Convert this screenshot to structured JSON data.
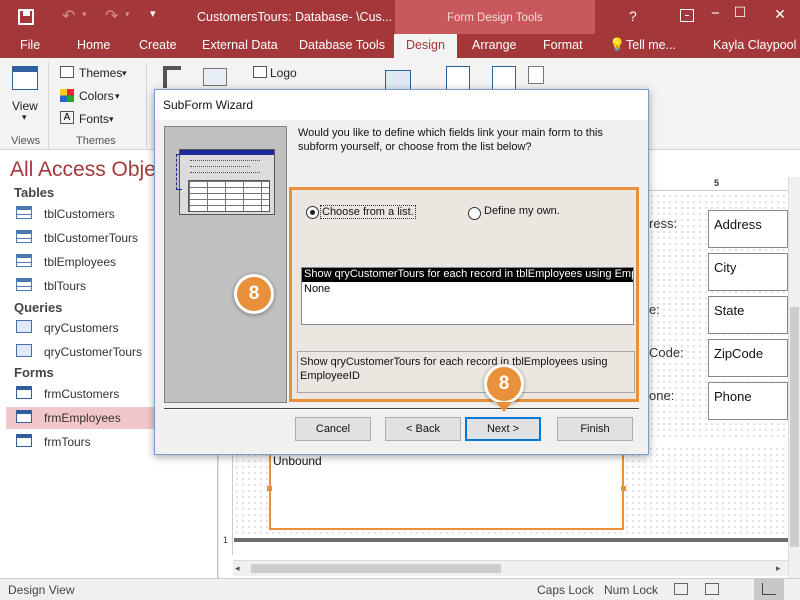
{
  "window": {
    "title": "CustomersTours: Database- \\Cus...",
    "context_tab_group": "Form Design Tools",
    "help_label": "?",
    "minimize_label": "−",
    "restore_label": "☐",
    "close_label": "✕"
  },
  "ribbon_tabs": {
    "file": "File",
    "home": "Home",
    "create": "Create",
    "external_data": "External Data",
    "database_tools": "Database Tools",
    "design": "Design",
    "arrange": "Arrange",
    "format": "Format",
    "tell_me": "Tell me...",
    "user": "Kayla Claypool"
  },
  "ribbon": {
    "view_label": "View",
    "views_group": "Views",
    "themes_label": "Themes",
    "colors_label": "Colors",
    "fonts_label": "Fonts",
    "themes_group": "Themes",
    "logo_label": "Logo"
  },
  "nav": {
    "title": "All Access Obje",
    "tables_header": "Tables",
    "tables": [
      "tblCustomers",
      "tblCustomerTours",
      "tblEmployees",
      "tblTours"
    ],
    "queries_header": "Queries",
    "queries": [
      "qryCustomers",
      "qryCustomerTours"
    ],
    "forms_header": "Forms",
    "forms": [
      "frmCustomers",
      "frmEmployees",
      "frmTours"
    ]
  },
  "design": {
    "ruler_mark": "5",
    "field_labels": [
      "ress:",
      "",
      "e:",
      "Code:",
      "one:"
    ],
    "field_boxes": [
      "Address",
      "City",
      "State",
      "ZipCode",
      "Phone"
    ],
    "subform_label": "Unbound",
    "vruler_mark": "1"
  },
  "dialog": {
    "title": "SubForm Wizard",
    "question": "Would you like to define which fields link your main form to this subform yourself, or choose from the list below?",
    "option_list": "Choose from a list.",
    "option_own": "Define my own.",
    "list_items": [
      "Show qryCustomerTours for each record in tblEmployees using EmployeeID",
      "None"
    ],
    "description": "Show qryCustomerTours for each record in tblEmployees using EmployeeID",
    "buttons": {
      "cancel": "Cancel",
      "back": "< Back",
      "next": "Next >",
      "finish": "Finish"
    }
  },
  "callouts": {
    "step1": "8",
    "step2": "8"
  },
  "status": {
    "left": "Design View",
    "caps": "Caps Lock",
    "num": "Num Lock"
  },
  "colors": {
    "title_bar": "#a4373a",
    "accent_orange": "#e8913a",
    "nav_selected": "#f2c7c9"
  }
}
